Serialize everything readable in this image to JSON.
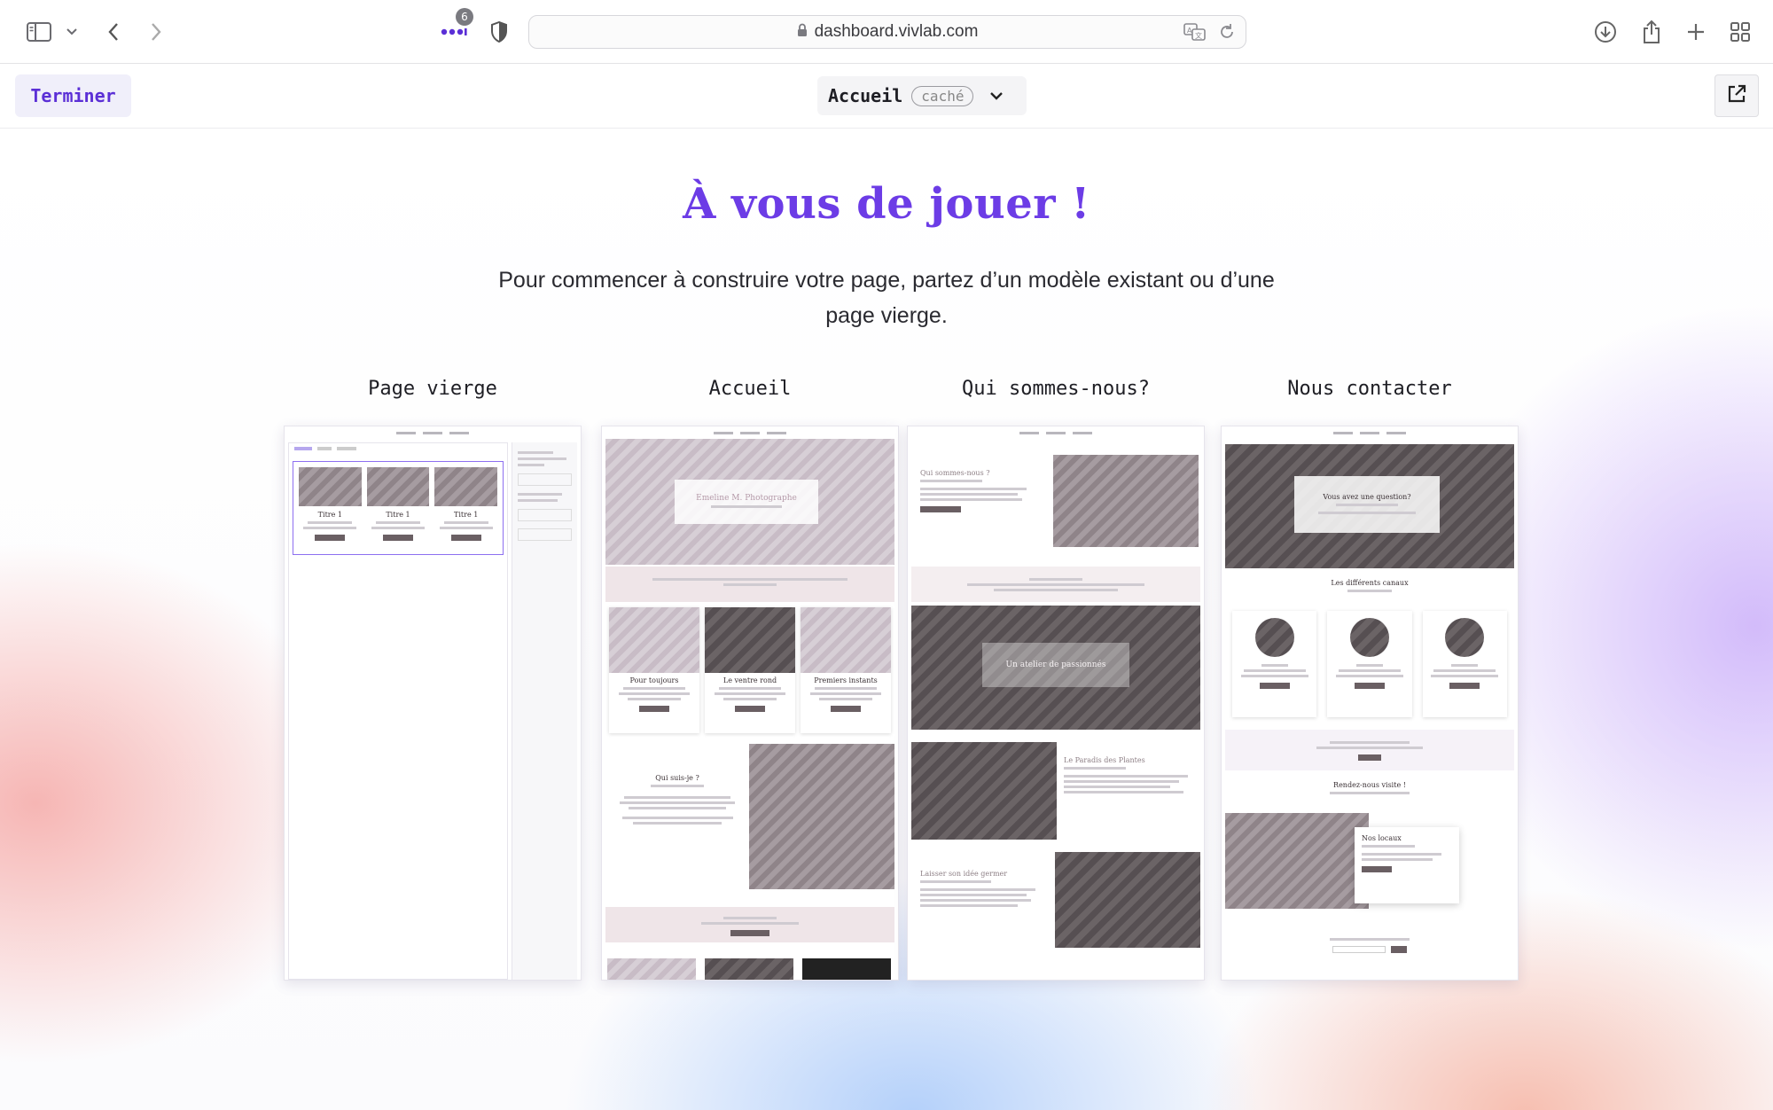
{
  "browser": {
    "url": "dashboard.vivlab.com",
    "tab_badge": "6"
  },
  "toolbar": {
    "finish_label": "Terminer",
    "page_name": "Accueil",
    "page_state": "caché"
  },
  "main": {
    "title": "À vous de jouer !",
    "intro": "Pour commencer à construire votre page, partez d’un modèle existant ou d’une page vierge."
  },
  "templates": [
    {
      "label": "Page vierge",
      "preview": {
        "col_titles": [
          "Titre 1",
          "Titre 1",
          "Titre 1"
        ]
      }
    },
    {
      "label": "Accueil",
      "preview": {
        "hero_title": "Emeline M. Photographe",
        "cards": [
          "Pour toujours",
          "Le ventre rond",
          "Premiers instants"
        ],
        "about_title": "Qui suis-je ?"
      }
    },
    {
      "label": "Qui sommes-nous?",
      "preview": {
        "intro_title": "Qui sommes-nous ?",
        "hero_title": "Un atelier de passionnés",
        "section_title": "Le Paradis des Plantes",
        "bottom_title": "Laisser son idée germer"
      }
    },
    {
      "label": "Nous contacter",
      "preview": {
        "hero_title": "Vous avez une question?",
        "channels_title": "Les différents canaux",
        "visit_title": "Rendez-nous visite !",
        "office_title": "Nos locaux"
      }
    }
  ],
  "colors": {
    "accent": "#6c3ce6",
    "finish_bg": "#f0effa"
  }
}
